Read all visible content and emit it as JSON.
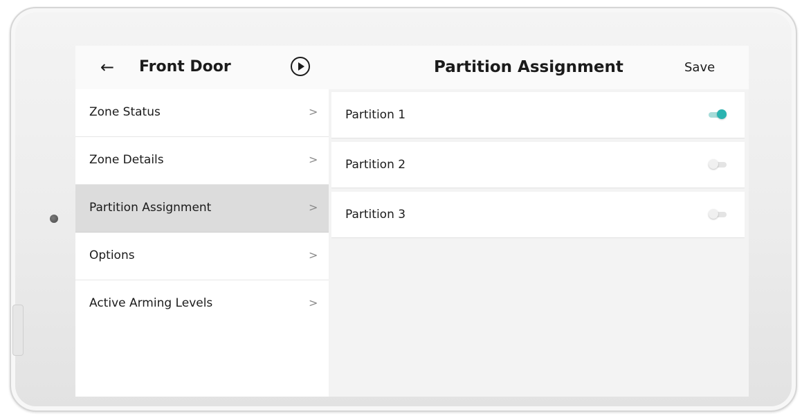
{
  "header": {
    "back_icon": "←",
    "zone_title": "Front Door",
    "play_icon": "play-circle-icon",
    "page_title": "Partition Assignment",
    "save_label": "Save"
  },
  "menu": {
    "chevron": ">",
    "items": [
      {
        "label": "Zone Status",
        "active": false
      },
      {
        "label": "Zone Details",
        "active": false
      },
      {
        "label": "Partition Assignment",
        "active": true
      },
      {
        "label": "Options",
        "active": false
      },
      {
        "label": "Active Arming Levels",
        "active": false
      }
    ]
  },
  "partitions": [
    {
      "label": "Partition 1",
      "enabled": true
    },
    {
      "label": "Partition 2",
      "enabled": false
    },
    {
      "label": "Partition 3",
      "enabled": false
    }
  ],
  "colors": {
    "accent": "#2bb3b0",
    "selected_row": "#dcdcdc"
  }
}
